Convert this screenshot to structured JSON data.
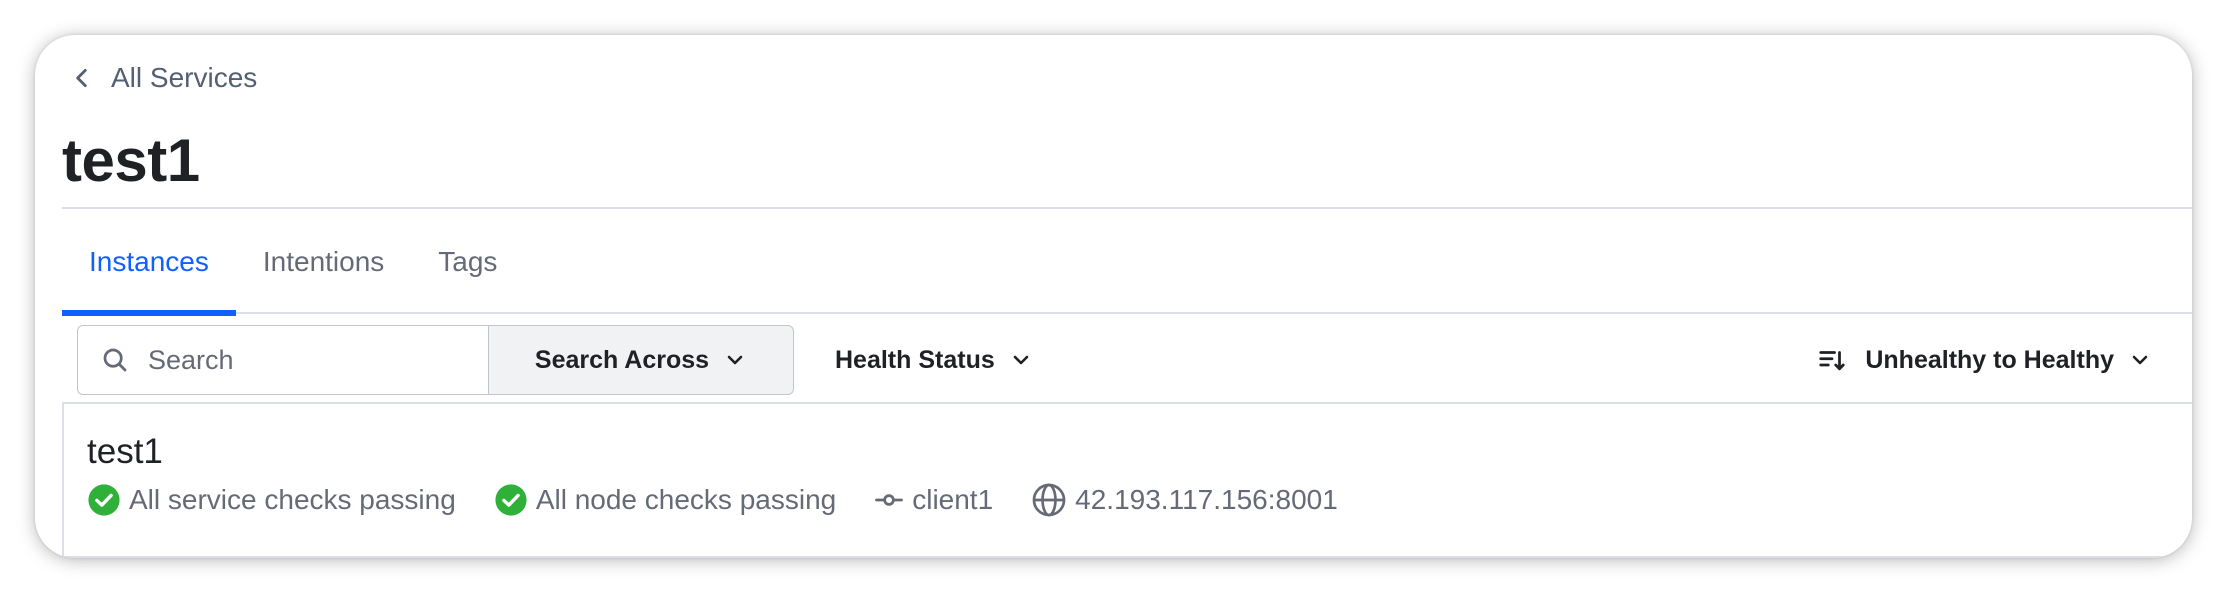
{
  "breadcrumb": {
    "back_label": "All Services"
  },
  "page": {
    "title": "test1"
  },
  "tabs": [
    {
      "label": "Instances",
      "active": true
    },
    {
      "label": "Intentions",
      "active": false
    },
    {
      "label": "Tags",
      "active": false
    }
  ],
  "toolbar": {
    "search_placeholder": "Search",
    "search_value": "",
    "search_across_label": "Search Across",
    "health_status_label": "Health Status",
    "sort_label": "Unhealthy to Healthy"
  },
  "instances": [
    {
      "name": "test1",
      "service_checks": "All service checks passing",
      "node_checks": "All node checks passing",
      "node": "client1",
      "address": "42.193.117.156:8001"
    }
  ],
  "colors": {
    "accent": "#1060ff",
    "passing": "#2eb039",
    "muted_text": "#656a76",
    "border": "#dce0e6"
  },
  "icons": {
    "back": "chevron-left-icon",
    "search": "search-icon",
    "dropdown": "chevron-down-icon",
    "sort": "sort-desc-icon",
    "passing": "check-circle-icon",
    "node": "git-commit-icon",
    "address": "globe-icon"
  }
}
